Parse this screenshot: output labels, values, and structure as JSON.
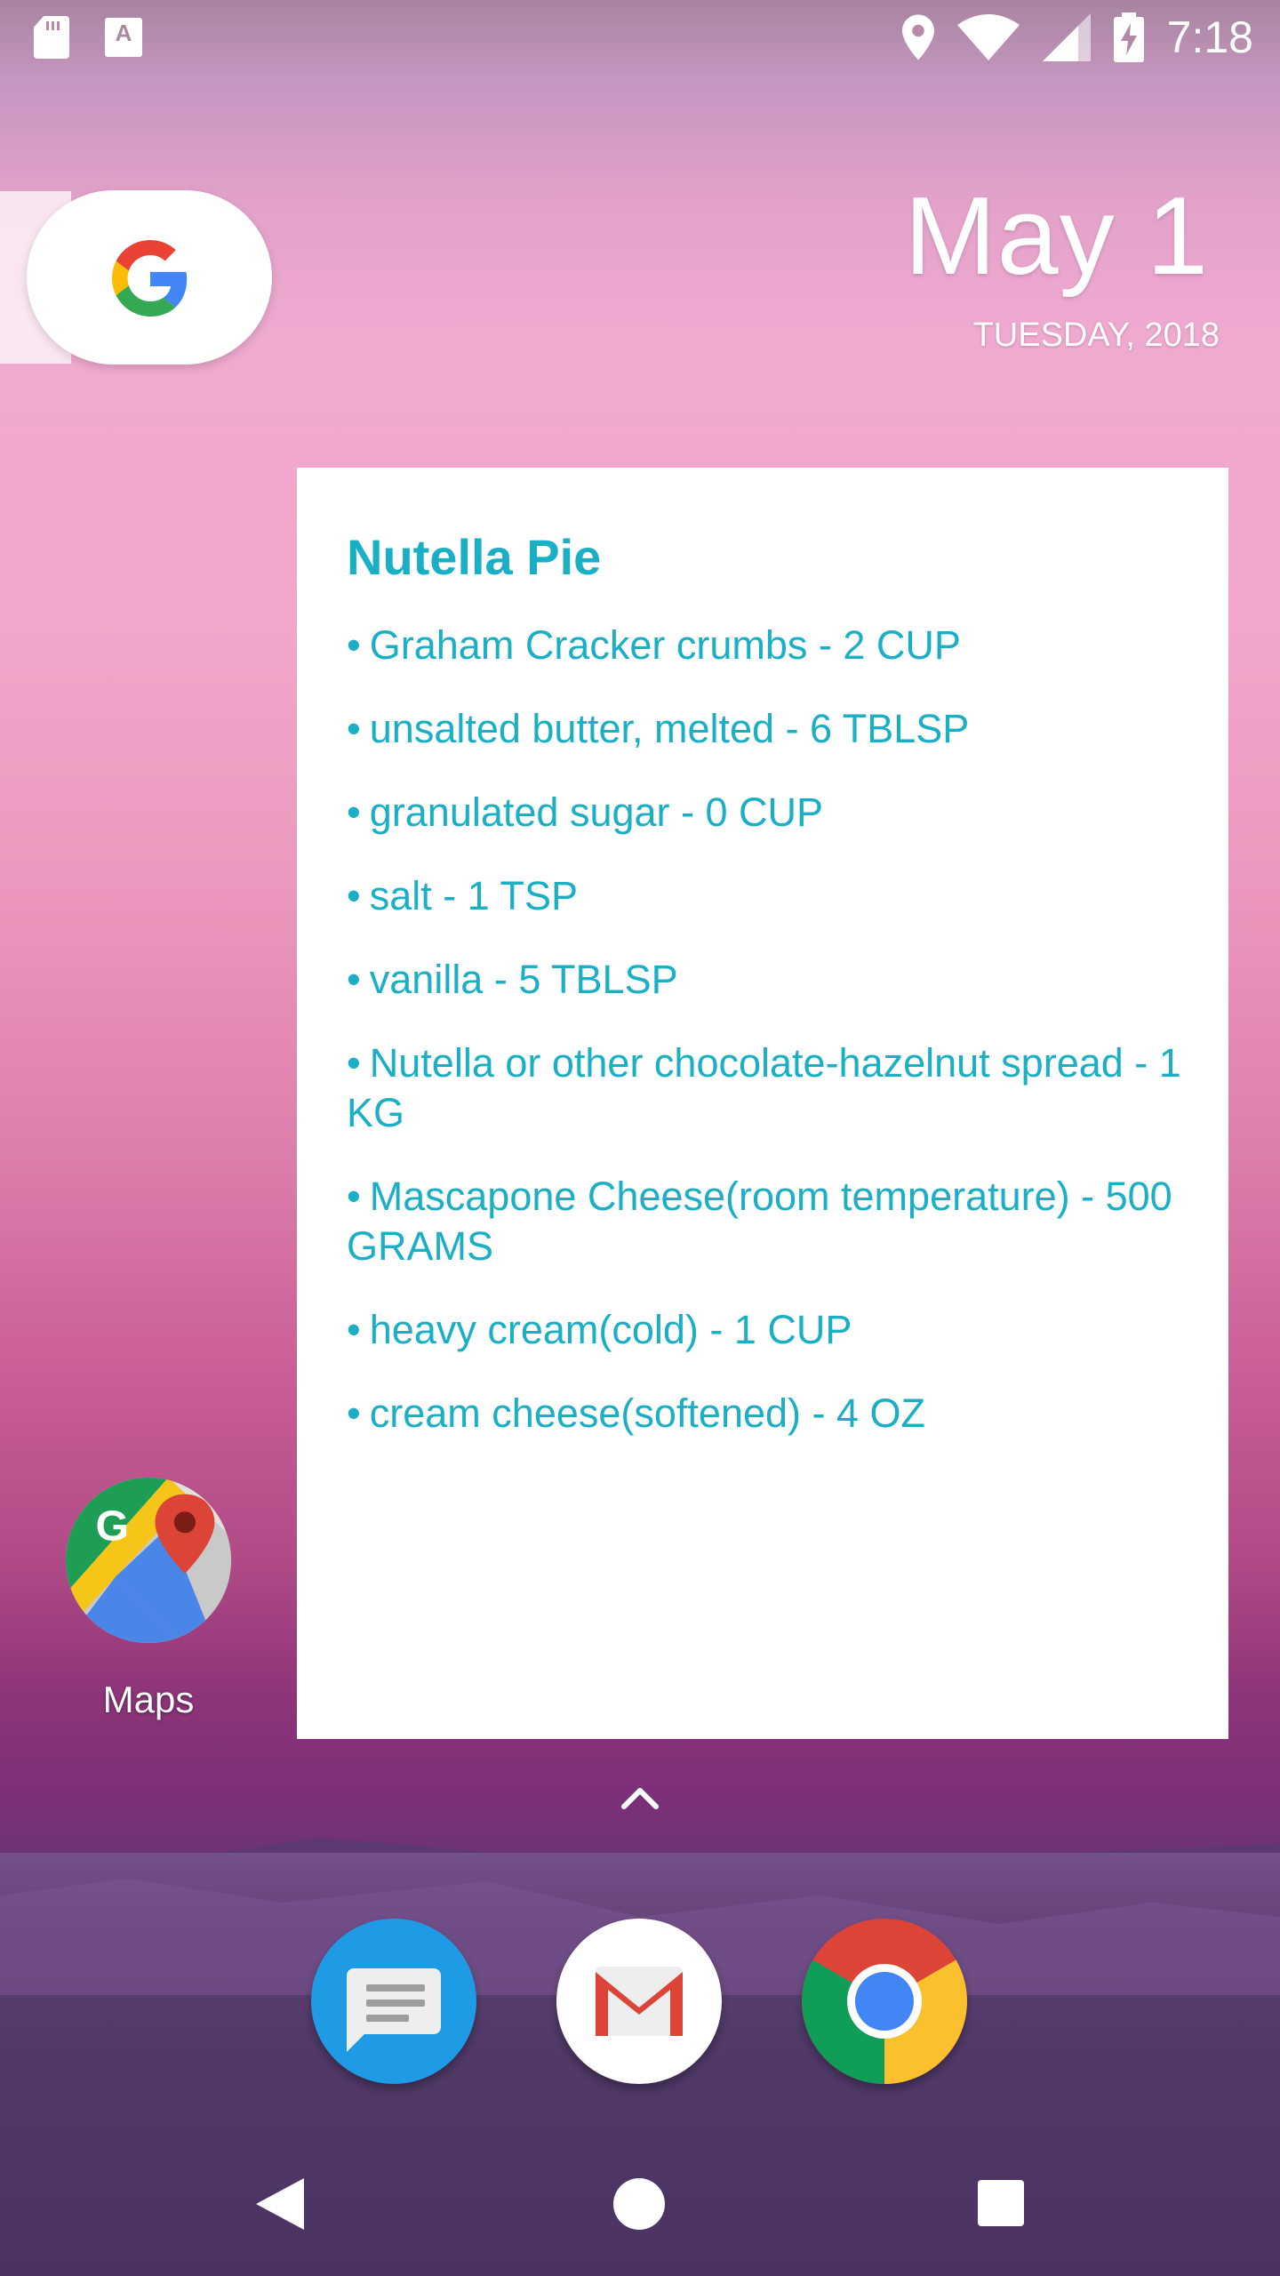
{
  "status_bar": {
    "time": "7:18",
    "left_icons": [
      "sd-card-icon",
      "autofill-a-icon"
    ],
    "right_icons": [
      "location-icon",
      "wifi-icon",
      "signal-icon",
      "battery-charging-icon"
    ],
    "autofill_glyph": "A"
  },
  "google_search": {
    "icon": "google-g-icon"
  },
  "date_widget": {
    "date": "May 1",
    "weekday_year": "TUESDAY, 2018"
  },
  "recipe_widget": {
    "title": "Nutella Pie",
    "bullet": "•",
    "accent_color": "#1bafc6",
    "ingredients": [
      "Graham Cracker crumbs - 2 CUP",
      "unsalted butter, melted - 6 TBLSP",
      "granulated sugar - 0 CUP",
      "salt - 1 TSP",
      "vanilla - 5 TBLSP",
      "Nutella or other chocolate-hazelnut spread - 1 KG",
      "Mascapone Cheese(room temperature) - 500 GRAMS",
      "heavy cream(cold) - 1 CUP",
      "cream cheese(softened) - 4 OZ"
    ]
  },
  "home_apps": [
    {
      "label": "Maps",
      "icon": "google-maps-icon"
    }
  ],
  "dock": [
    {
      "icon": "messages-icon",
      "color": "#1f9be6"
    },
    {
      "icon": "gmail-icon",
      "color": "#ffffff"
    },
    {
      "icon": "chrome-icon",
      "color": "#db4437"
    }
  ],
  "nav_bar": {
    "icons": [
      "back-icon",
      "home-icon",
      "recents-icon"
    ]
  }
}
